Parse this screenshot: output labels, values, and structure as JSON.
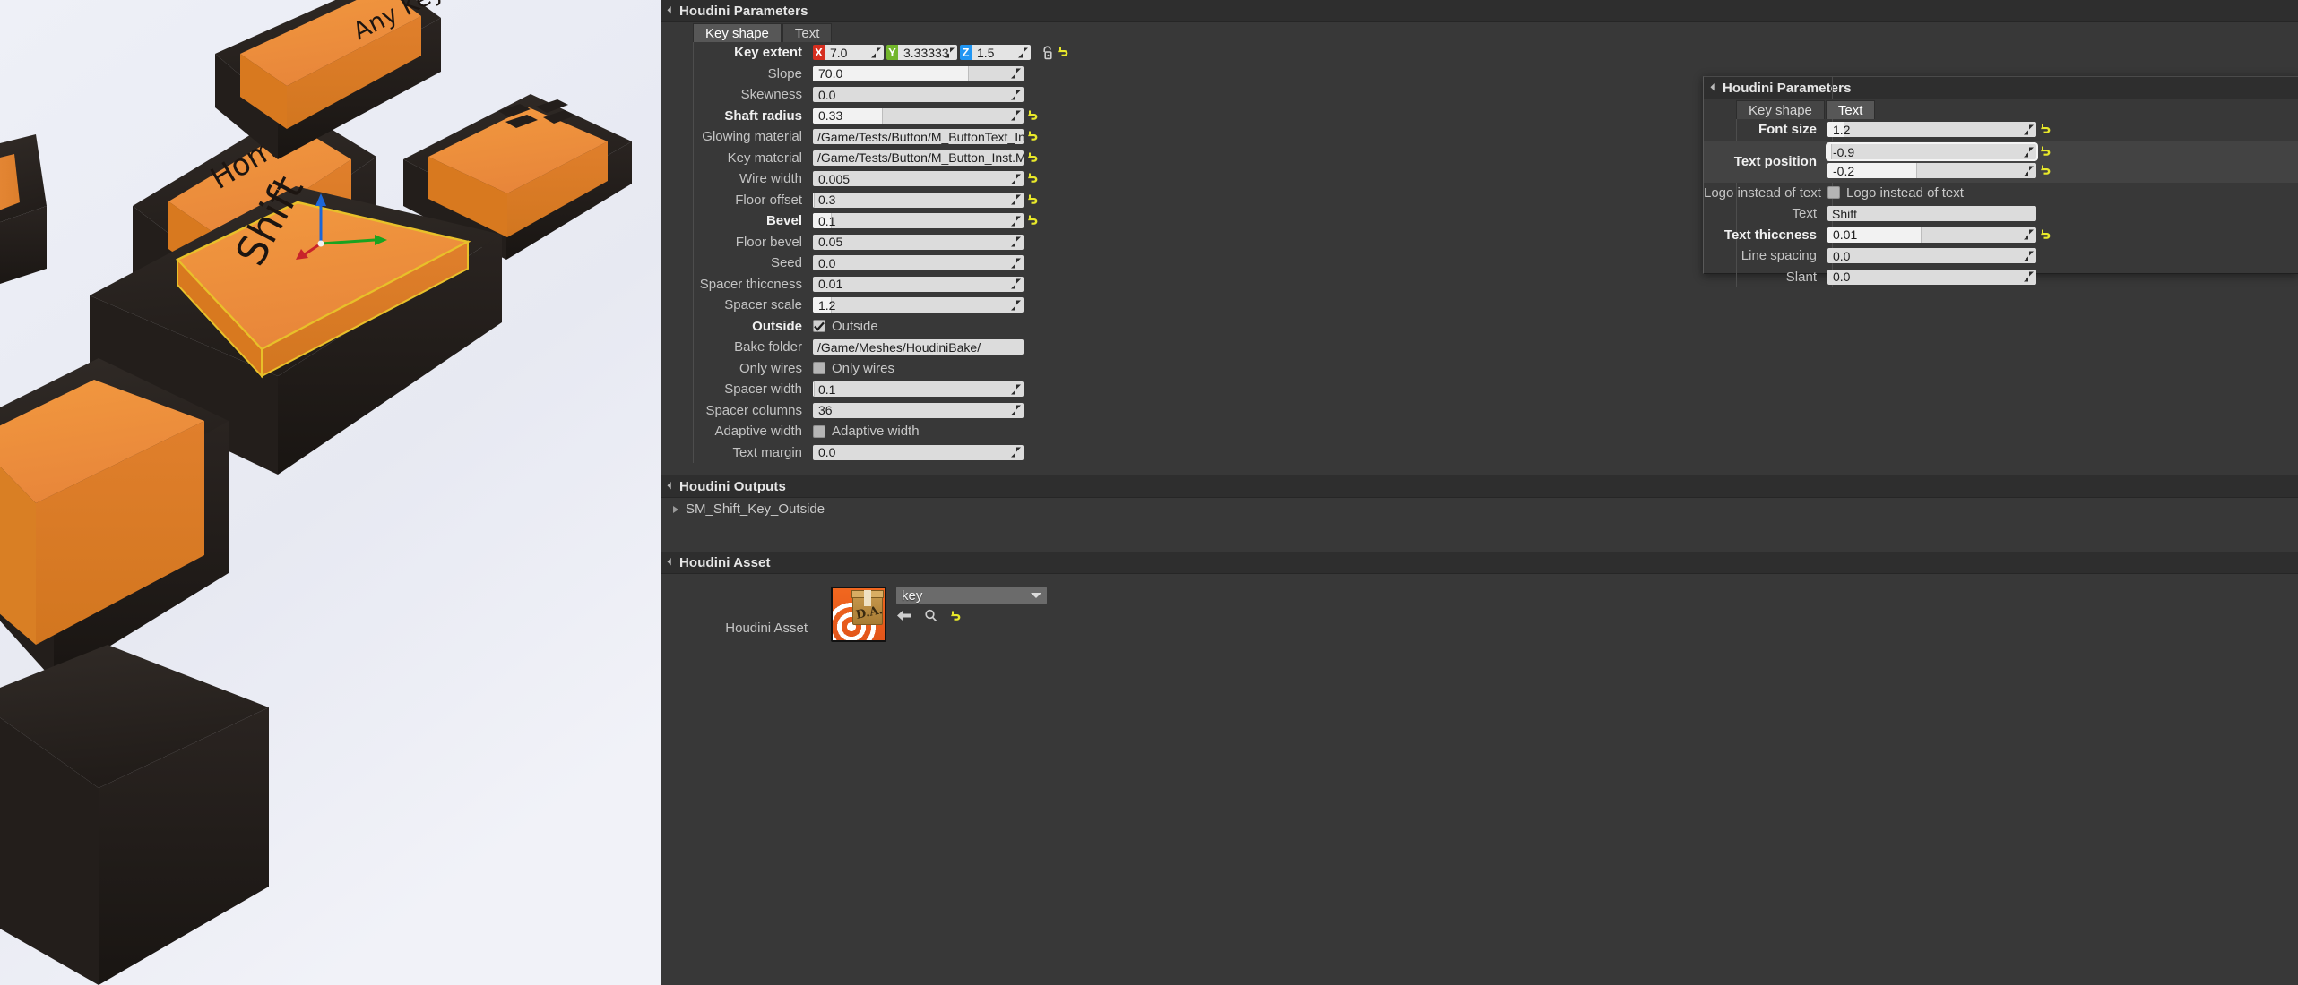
{
  "viewport": {
    "name": "level-viewport",
    "background_color": "#ebedf5",
    "keycap_color": "#ef8b33",
    "keycap_base_color": "#2a2522",
    "selection_outline_color": "#e8c02a",
    "keys": [
      {
        "label": "Home"
      },
      {
        "label": "Any Key"
      },
      {
        "label": "Shift"
      }
    ]
  },
  "main_panel": {
    "category_title": "Houdini Parameters",
    "tabs": [
      {
        "label": "Key shape",
        "active": true
      },
      {
        "label": "Text",
        "active": false
      }
    ],
    "rows": [
      {
        "label": "Key extent",
        "bold": true,
        "type": "vector",
        "components": [
          {
            "axis": "X",
            "value": "7.0",
            "color": "#d62e1f"
          },
          {
            "axis": "Y",
            "value": "3.33333",
            "color": "#72b62b"
          },
          {
            "axis": "Z",
            "value": "1.5",
            "color": "#2196f3"
          }
        ],
        "lock": true,
        "reset": true
      },
      {
        "label": "Slope",
        "type": "slider",
        "value": "70.0",
        "fill_pct": 74,
        "reset": false
      },
      {
        "label": "Skewness",
        "type": "number",
        "value": "0.0",
        "reset": false
      },
      {
        "label": "Shaft radius",
        "bold": true,
        "type": "slider",
        "value": "0.33",
        "fill_pct": 33,
        "reset": true
      },
      {
        "label": "Glowing material",
        "type": "text",
        "value": "/Game/Tests/Button/M_ButtonText_Inst.M_ButtonText",
        "reset": true
      },
      {
        "label": "Key material",
        "type": "text",
        "value": "/Game/Tests/Button/M_Button_Inst.M_Button_Inst",
        "reset": true
      },
      {
        "label": "Wire width",
        "type": "number",
        "value": "0.005",
        "reset": true
      },
      {
        "label": "Floor offset",
        "type": "slider",
        "value": "0.3",
        "fill_pct": 1,
        "reset": true
      },
      {
        "label": "Bevel",
        "bold": true,
        "type": "slider",
        "value": "0.1",
        "fill_pct": 9,
        "reset": true
      },
      {
        "label": "Floor bevel",
        "type": "number",
        "value": "0.05",
        "reset": false
      },
      {
        "label": "Seed",
        "type": "number",
        "value": "0.0",
        "reset": false
      },
      {
        "label": "Spacer thiccness",
        "type": "number",
        "value": "0.01",
        "reset": false
      },
      {
        "label": "Spacer scale",
        "type": "slider",
        "value": "1.2",
        "fill_pct": 9,
        "reset": false
      },
      {
        "label": "Outside",
        "bold": true,
        "type": "checkbox",
        "checked": true,
        "checkbox_label": "Outside"
      },
      {
        "label": "Bake folder",
        "type": "text",
        "value": "/Game/Meshes/HoudiniBake/",
        "reset": false
      },
      {
        "label": "Only wires",
        "type": "checkbox",
        "checked": false,
        "checkbox_label": "Only wires"
      },
      {
        "label": "Spacer width",
        "type": "slider",
        "value": "0.1",
        "fill_pct": 1,
        "reset": false
      },
      {
        "label": "Spacer columns",
        "type": "number",
        "value": "36",
        "reset": false
      },
      {
        "label": "Adaptive width",
        "type": "checkbox",
        "checked": false,
        "checkbox_label": "Adaptive width"
      },
      {
        "label": "Text margin",
        "type": "number",
        "value": "0.0",
        "reset": false
      }
    ]
  },
  "outputs_section": {
    "category_title": "Houdini Outputs",
    "items": [
      {
        "label": "SM_Shift_Key_Outside"
      }
    ]
  },
  "asset_section": {
    "category_title": "Houdini Asset",
    "row_label": "Houdini Asset",
    "asset_name": "key",
    "thumb_badge": "D.A.",
    "buttons": [
      {
        "name": "browse-back-icon"
      },
      {
        "name": "search-asset-icon"
      },
      {
        "name": "reset-asset-icon"
      }
    ]
  },
  "float_panel": {
    "category_title": "Houdini Parameters",
    "tabs": [
      {
        "label": "Key shape",
        "active": false
      },
      {
        "label": "Text",
        "active": true
      }
    ],
    "rows": [
      {
        "label": "Font size",
        "bold": true,
        "type": "slider",
        "value": "1.2",
        "fill_pct": 8,
        "reset": true
      },
      {
        "label": "Text position",
        "bold": true,
        "type": "vector2-stacked",
        "highlight": true,
        "components": [
          {
            "value": "-0.9",
            "fill_pct": 2,
            "reset": true
          },
          {
            "value": "-0.2",
            "fill_pct": 43,
            "reset": true
          }
        ]
      },
      {
        "label": "Logo instead of text",
        "type": "checkbox",
        "checked": false,
        "checkbox_label": "Logo instead of text"
      },
      {
        "label": "Text",
        "type": "text",
        "value": "Shift",
        "reset": false
      },
      {
        "label": "Text thiccness",
        "bold": true,
        "type": "slider",
        "value": "0.01",
        "fill_pct": 45,
        "reset": true
      },
      {
        "label": "Line spacing",
        "type": "number",
        "value": "0.0",
        "reset": false
      },
      {
        "label": "Slant",
        "type": "number",
        "value": "0.0",
        "reset": false
      }
    ]
  },
  "theme": {
    "panel_bg": "#383838",
    "header_bg": "#2e2e2e",
    "field_bg": "#dcdcdc",
    "reset_icon_color": "#e8e82a",
    "accent_orange": "#ef8b33"
  }
}
